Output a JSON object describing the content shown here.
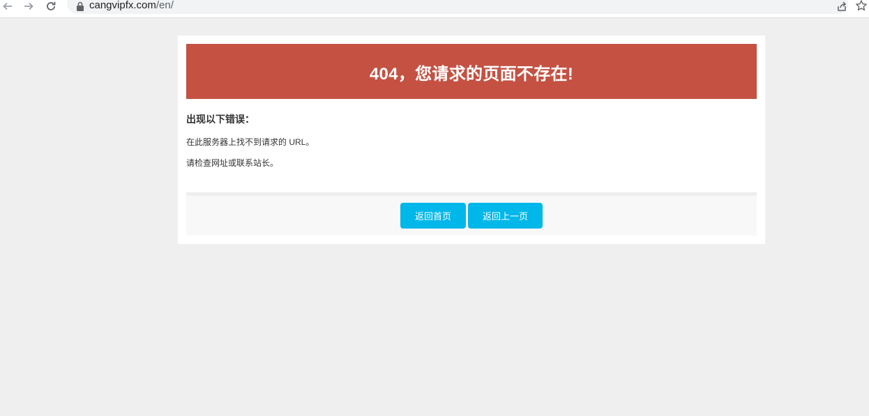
{
  "browser": {
    "url_host": "cangvipfx.com",
    "url_path": "/en/"
  },
  "page": {
    "banner_title": "404，您请求的页面不存在!",
    "error_heading": "出现以下错误：",
    "error_lines": [
      "在此服务器上找不到请求的 URL。",
      "请检查网址或联系站长。"
    ],
    "buttons": {
      "home": "返回首页",
      "back": "返回上一页"
    }
  },
  "colors": {
    "banner": "#c45142",
    "button": "#00b7ea",
    "background": "#efefef"
  }
}
